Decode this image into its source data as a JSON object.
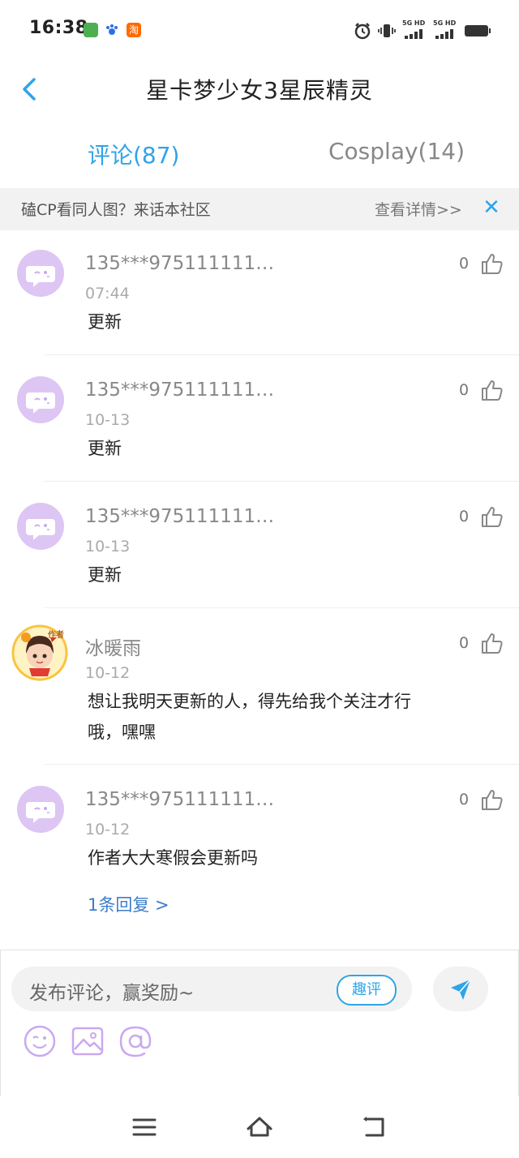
{
  "status_bar": {
    "time": "16:38",
    "network_1": "5G HD",
    "network_2": "5G HD"
  },
  "header": {
    "title": "星卡梦少女3星辰精灵"
  },
  "tabs": [
    {
      "label": "评论(87)",
      "active": true
    },
    {
      "label": "Cosplay(14)",
      "active": false
    }
  ],
  "banner": {
    "text": "磕CP看同人图？来话本社区",
    "link": "查看详情>>",
    "close": "✕"
  },
  "comments": [
    {
      "username": "135***975111111…",
      "date": "07:44",
      "text": "更新",
      "likes": "0"
    },
    {
      "username": "135***975111111…",
      "date": "10-13",
      "text": "更新",
      "likes": "0"
    },
    {
      "username": "135***975111111…",
      "date": "10-13",
      "text": "更新",
      "likes": "0"
    },
    {
      "username": "冰暖雨",
      "date": "10-12",
      "text_line1": "想让我明天更新的人，得先给我个关注才行",
      "text_line2": "哦，嘿嘿",
      "likes": "0",
      "badge": "作者"
    },
    {
      "username": "135***975111111…",
      "date": "10-12",
      "text": "作者大大寒假会更新吗",
      "likes": "0",
      "reply": "1条回复 >"
    }
  ],
  "composer": {
    "placeholder": "发布评论，赢奖励~",
    "fun_button": "趣评"
  },
  "colors": {
    "accent": "#2fa4e7",
    "avatar_bg": "#ddc6f3",
    "link": "#3d7ec9"
  }
}
